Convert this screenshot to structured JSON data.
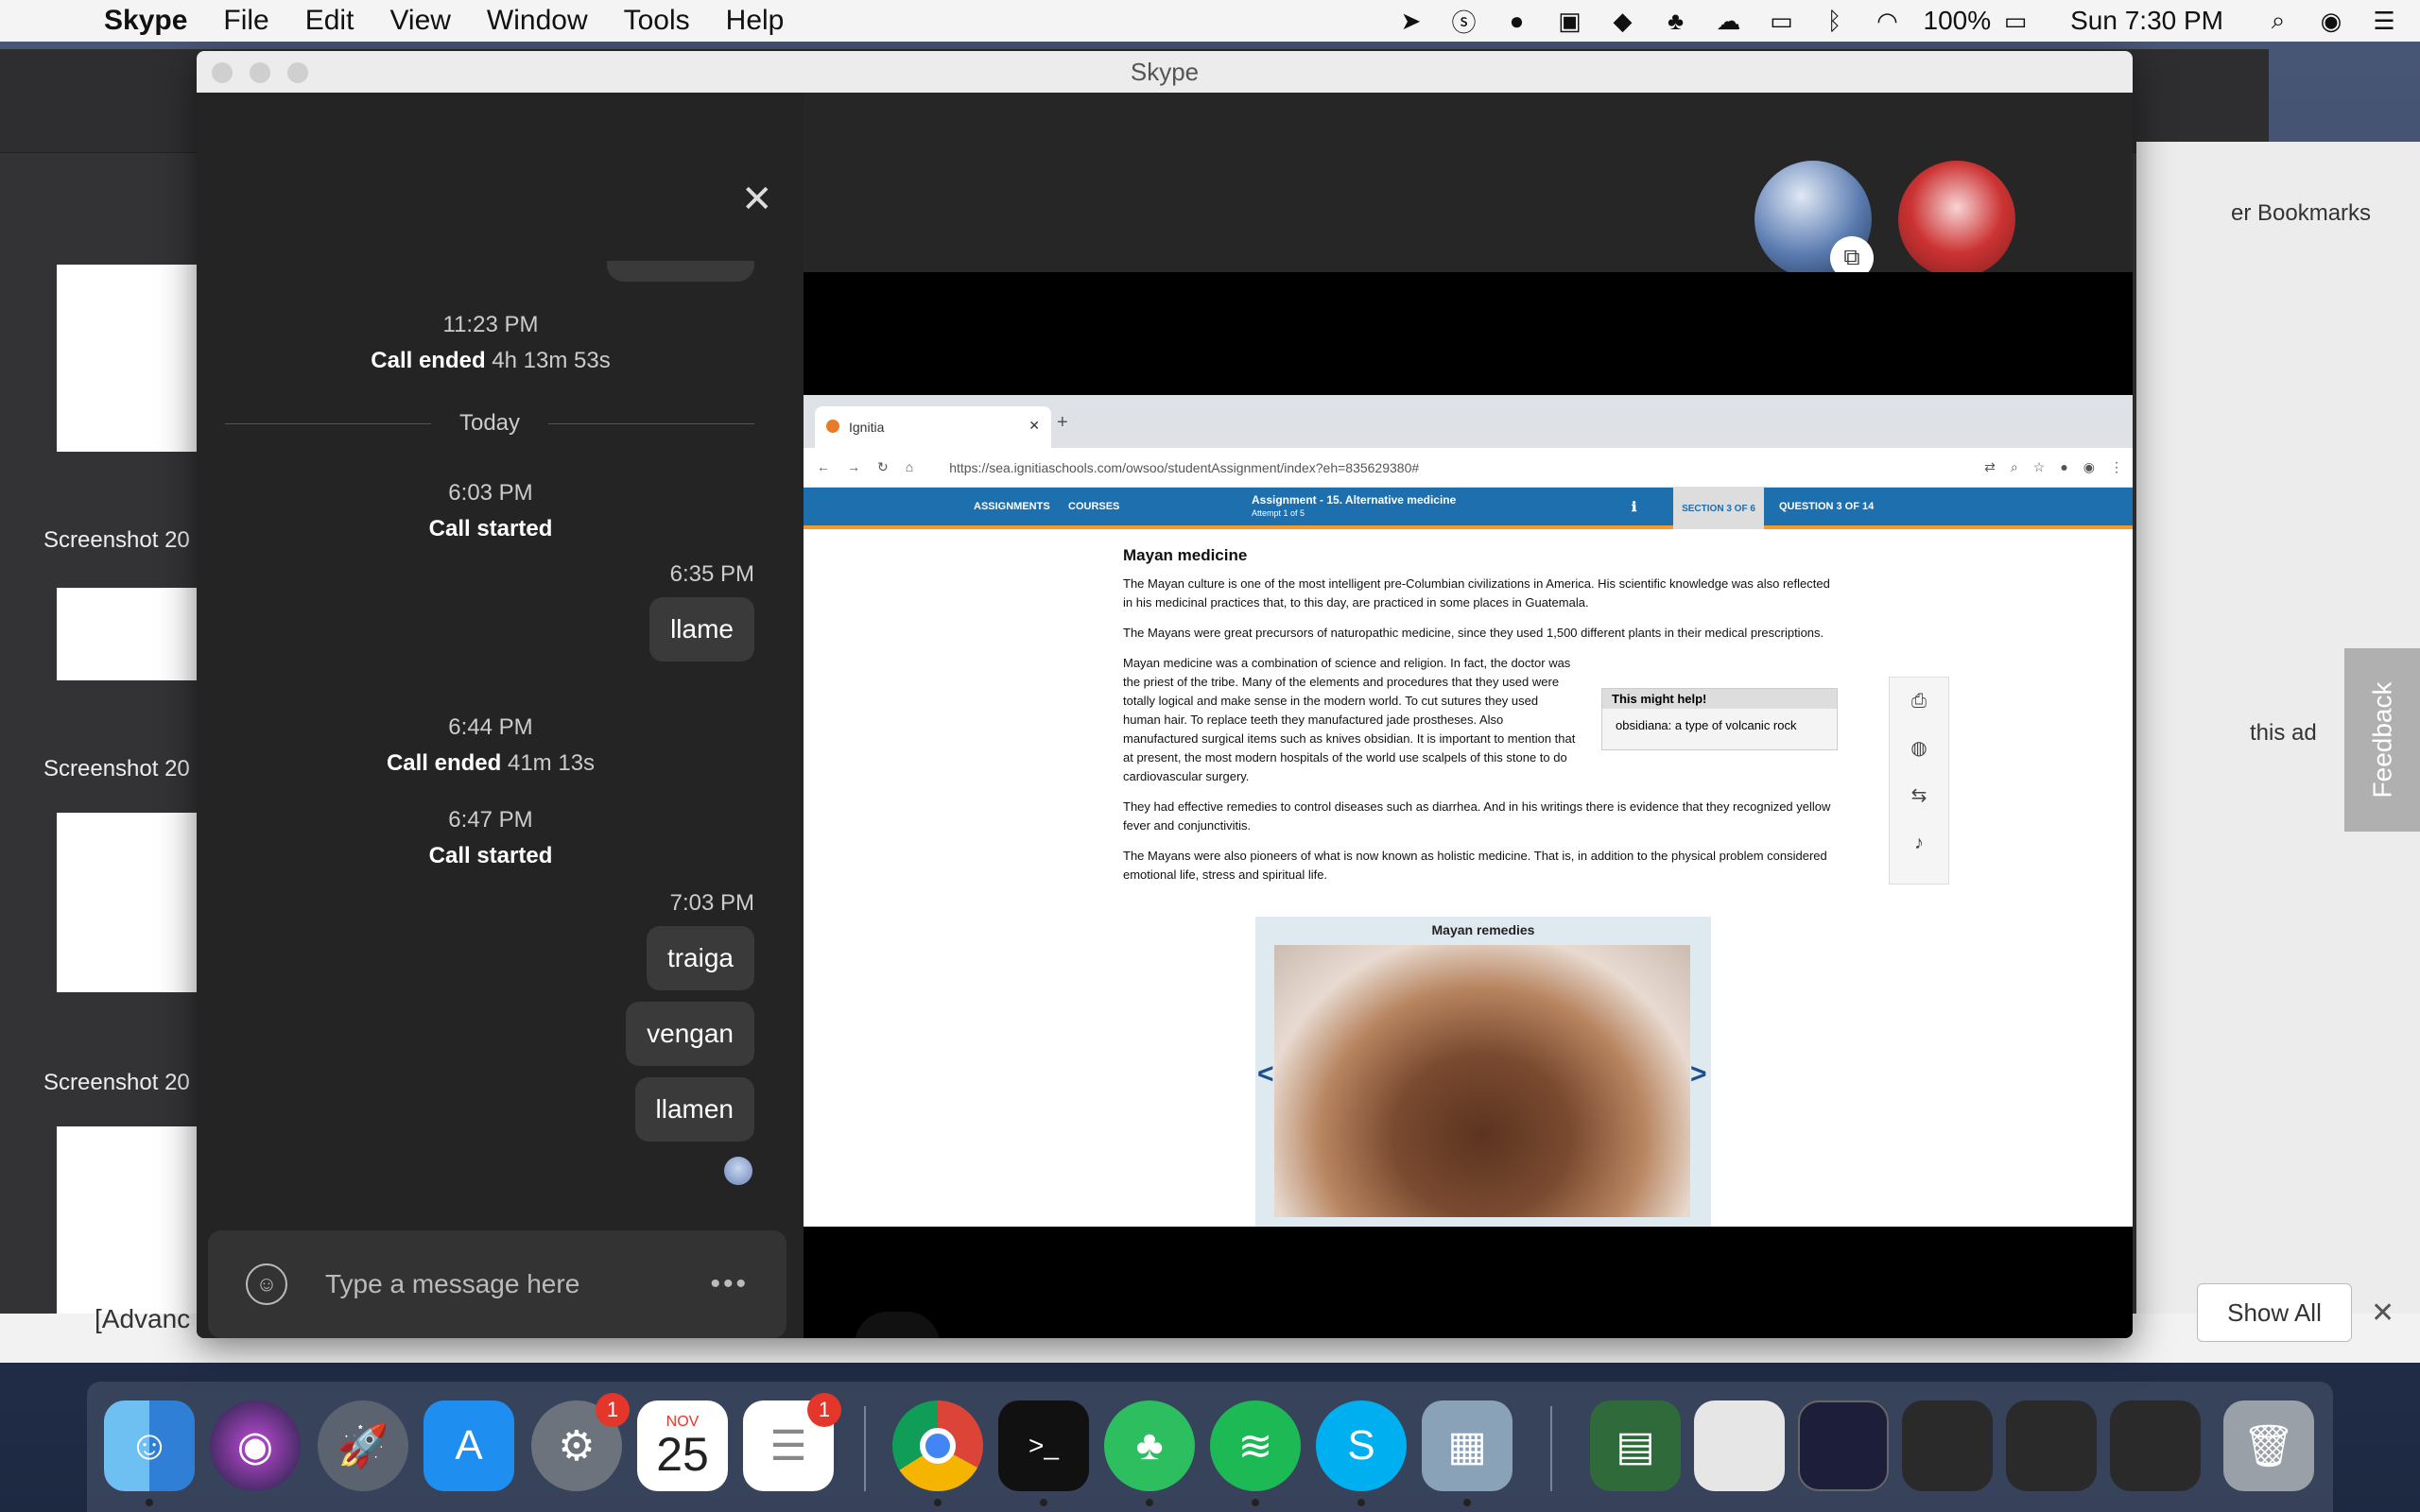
{
  "menubar": {
    "app_name": "Skype",
    "menus": [
      "File",
      "Edit",
      "View",
      "Window",
      "Tools",
      "Help"
    ],
    "battery": "100%",
    "clock": "Sun 7:30 PM",
    "icons": [
      "location-arrow-icon",
      "skype-icon",
      "notification-icon",
      "display-icon",
      "dropbox-icon",
      "evernote-icon",
      "creative-cloud-icon",
      "airplay-icon",
      "bluetooth-icon",
      "wifi-icon",
      "battery-icon",
      "spotlight-icon",
      "siri-icon",
      "control-center-icon"
    ]
  },
  "background_window": {
    "thumbnails": [
      {
        "label": "Screenshot 20"
      },
      {
        "label": "Screenshot 20"
      },
      {
        "label": "Screenshot 20"
      }
    ],
    "bookmarks_text": "er Bookmarks",
    "ad_text": "this ad",
    "feedback_label": "Feedback",
    "show_all_label": "Show All",
    "download_name": "[Advanc"
  },
  "skype": {
    "title": "Skype",
    "messages": {
      "entries": [
        {
          "time": "11:23 PM",
          "event": "Call ended",
          "duration": "4h 13m 53s"
        },
        {
          "divider": "Today"
        },
        {
          "time": "6:03 PM",
          "event": "Call started"
        },
        {
          "sent_time": "6:35 PM",
          "text": "llame"
        },
        {
          "time": "6:44 PM",
          "event": "Call ended",
          "duration": "41m 13s"
        },
        {
          "time": "6:47 PM",
          "event": "Call started"
        },
        {
          "sent_time": "7:03 PM",
          "bubbles": [
            "traiga",
            "vengan",
            "llamen"
          ]
        }
      ]
    },
    "composer": {
      "placeholder": "Type a message here"
    }
  },
  "shared_browser": {
    "tab_title": "Ignitia",
    "url": "https://sea.ignitiaschools.com/owsoo/studentAssignment/index?eh=835629380#",
    "nav": {
      "assignments": "ASSIGNMENTS",
      "courses": "COURSES",
      "assignment_title": "Assignment - 15. Alternative medicine",
      "attempt": "Attempt 1 of 5",
      "section": "SECTION 3 OF 6",
      "question": "QUESTION 3 OF 14"
    },
    "article": {
      "heading": "Mayan medicine",
      "p1": "The Mayan culture is one of the most intelligent pre-Columbian civilizations in America. His scientific knowledge was also reflected in his medicinal practices that, to this day, are practiced in some places in Guatemala.",
      "p2": "The Mayans were great precursors of naturopathic medicine, since they used 1,500 different plants in their medical prescriptions.",
      "p3": "Mayan medicine was a combination of science and religion. In fact, the doctor was the priest of the tribe. Many of the elements and procedures that they used were totally logical and make sense in the modern world. To cut sutures they used human hair. To replace teeth they manufactured jade prostheses. Also manufactured surgical items such as knives obsidian. It is important to mention that at present, the most modern hospitals of the world use scalpels of this stone to do cardiovascular surgery.",
      "p4": "They had effective remedies to control diseases such as diarrhea. And in his writings there is evidence that they recognized yellow fever and conjunctivitis.",
      "p5": "The Mayans were also pioneers of what is now known as holistic medicine. That is, in addition to the physical problem considered emotional life, stress and spiritual life."
    },
    "help": {
      "title": "This might help!",
      "body": "obsidiana: a type of volcanic rock"
    },
    "gallery": {
      "title": "Mayan remedies"
    }
  },
  "dock": {
    "calendar_month": "NOV",
    "calendar_day": "25",
    "badge_settings": "1",
    "badge_reminders": "1"
  }
}
